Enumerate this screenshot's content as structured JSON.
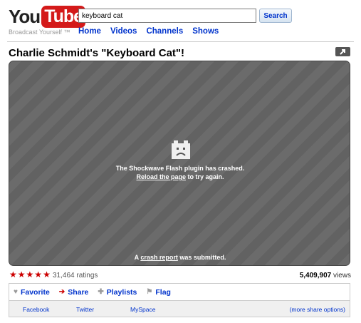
{
  "header": {
    "logo_you": "You",
    "logo_tube": "Tube",
    "tagline": "Broadcast Yourself ™",
    "search_value": "keyboard cat",
    "search_button": "Search",
    "nav": [
      "Home",
      "Videos",
      "Channels",
      "Shows"
    ]
  },
  "video": {
    "title": "Charlie Schmidt's \"Keyboard Cat\"!",
    "crash_line1": "The Shockwave Flash plugin has crashed.",
    "crash_link": "Reload the page",
    "crash_line2_rest": " to try again.",
    "report_prefix": "A ",
    "report_link": "crash report",
    "report_suffix": " was submitted."
  },
  "stats": {
    "stars": 5,
    "ratings": "31,464 ratings",
    "views_number": "5,409,907",
    "views_label": " views"
  },
  "actions": [
    {
      "label": "Favorite",
      "icon": "heart-icon"
    },
    {
      "label": "Share",
      "icon": "arrow-right-icon"
    },
    {
      "label": "Playlists",
      "icon": "plus-icon"
    },
    {
      "label": "Flag",
      "icon": "flag-icon"
    }
  ],
  "share": {
    "facebook": "Facebook",
    "twitter": "Twitter",
    "myspace": "MySpace",
    "more": "(more share options)"
  },
  "colors": {
    "brand_red": "#d41a1a",
    "link_blue": "#0033cc",
    "star_red": "#cc0000",
    "player_gray": "#6b6b6b"
  }
}
